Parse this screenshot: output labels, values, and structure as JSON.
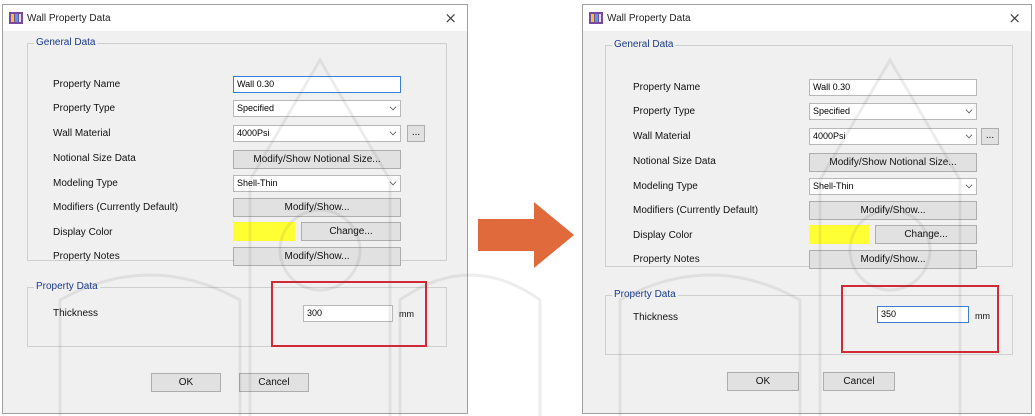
{
  "colors": {
    "accent_text": "#1a3a8c",
    "highlight_box": "#d12a36",
    "display_color": "#ffff33",
    "arrow": "#e06a3c"
  },
  "icons": {
    "app": "app-icon",
    "close": "close-icon",
    "arrow": "right-arrow-icon",
    "chevron": "chevron-down-icon",
    "watermark": "university-seal-watermark"
  },
  "dialogs": [
    {
      "title": "Wall Property Data",
      "close_label": "×",
      "general_data": {
        "title": "General Data",
        "property_name_label": "Property Name",
        "property_name_value": "Wall 0.30",
        "property_type_label": "Property Type",
        "property_type_value": "Specified",
        "wall_material_label": "Wall Material",
        "wall_material_value": "4000Psi",
        "ellipsis_label": "...",
        "notional_label": "Notional Size Data",
        "notional_button": "Modify/Show Notional Size...",
        "modeling_label": "Modeling Type",
        "modeling_value": "Shell-Thin",
        "modifiers_label": "Modifiers (Currently Default)",
        "modifiers_button": "Modify/Show...",
        "display_color_label": "Display Color",
        "change_button": "Change...",
        "notes_label": "Property Notes",
        "notes_button": "Modify/Show..."
      },
      "property_data": {
        "title": "Property Data",
        "thickness_label": "Thickness",
        "thickness_value": "300",
        "unit": "mm"
      },
      "ok_button": "OK",
      "cancel_button": "Cancel"
    },
    {
      "title": "Wall Property Data",
      "close_label": "×",
      "general_data": {
        "title": "General Data",
        "property_name_label": "Property Name",
        "property_name_value": "Wall 0.30",
        "property_type_label": "Property Type",
        "property_type_value": "Specified",
        "wall_material_label": "Wall Material",
        "wall_material_value": "4000Psi",
        "ellipsis_label": "...",
        "notional_label": "Notional Size Data",
        "notional_button": "Modify/Show Notional Size...",
        "modeling_label": "Modeling Type",
        "modeling_value": "Shell-Thin",
        "modifiers_label": "Modifiers (Currently Default)",
        "modifiers_button": "Modify/Show...",
        "display_color_label": "Display Color",
        "change_button": "Change...",
        "notes_label": "Property Notes",
        "notes_button": "Modify/Show..."
      },
      "property_data": {
        "title": "Property Data",
        "thickness_label": "Thickness",
        "thickness_value": "350",
        "unit": "mm"
      },
      "ok_button": "OK",
      "cancel_button": "Cancel"
    }
  ]
}
